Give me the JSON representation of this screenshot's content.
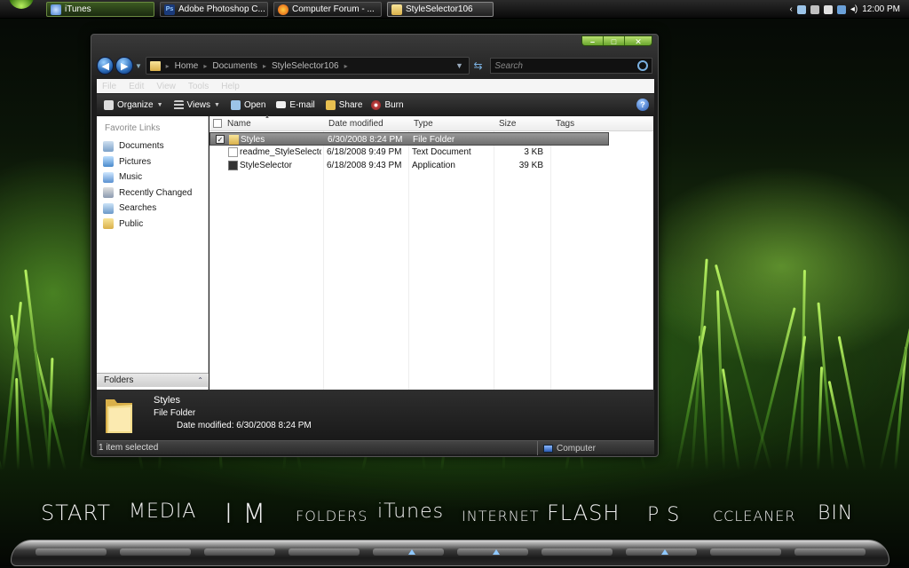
{
  "taskbar": {
    "buttons": [
      {
        "label": "iTunes",
        "icon": "itunes-icon"
      },
      {
        "label": "Adobe Photoshop C...",
        "icon": "photoshop-icon",
        "icon_text": "Ps"
      },
      {
        "label": "Computer Forum - ...",
        "icon": "firefox-icon"
      },
      {
        "label": "StyleSelector106",
        "icon": "folder-icon"
      }
    ],
    "clock": "12:00 PM"
  },
  "window": {
    "caption": {
      "minimize": "–",
      "maximize": "□",
      "close": "✕"
    },
    "nav": {
      "back": "◀",
      "forward": "▶"
    },
    "address": {
      "crumbs": [
        "Home",
        "Documents",
        "StyleSelector106"
      ]
    },
    "search": {
      "placeholder": "Search"
    },
    "menubar": [
      "File",
      "Edit",
      "View",
      "Tools",
      "Help"
    ],
    "toolbar": {
      "organize": "Organize",
      "views": "Views",
      "open": "Open",
      "email": "E-mail",
      "share": "Share",
      "burn": "Burn",
      "help": "?"
    },
    "nav_pane": {
      "title": "Favorite Links",
      "links": [
        "Documents",
        "Pictures",
        "Music",
        "Recently Changed",
        "Searches",
        "Public"
      ],
      "folders_label": "Folders"
    },
    "columns": {
      "name": "Name",
      "date": "Date modified",
      "type": "Type",
      "size": "Size",
      "tags": "Tags"
    },
    "files": [
      {
        "name": "Styles",
        "date": "6/30/2008 8:24 PM",
        "type": "File Folder",
        "size": "",
        "check": "✓"
      },
      {
        "name": "readme_StyleSelector",
        "date": "6/18/2008 9:49 PM",
        "type": "Text Document",
        "size": "3 KB"
      },
      {
        "name": "StyleSelector",
        "date": "6/18/2008 9:43 PM",
        "type": "Application",
        "size": "39 KB"
      }
    ],
    "details": {
      "name": "Styles",
      "type": "File Folder",
      "modified": "Date modified: 6/30/2008 8:24 PM"
    },
    "status": {
      "selected": "1 item selected",
      "location": "Computer"
    }
  },
  "dock": {
    "items": [
      "START",
      "MEDIA",
      "I M",
      "FOLDERS",
      "iTunes",
      "INTERNET",
      "FLASH",
      "P S",
      "CCLEANER",
      "BIN"
    ]
  },
  "colors": {
    "accent_green": "#7ab830",
    "selection_gray": "#7a7a7a"
  }
}
